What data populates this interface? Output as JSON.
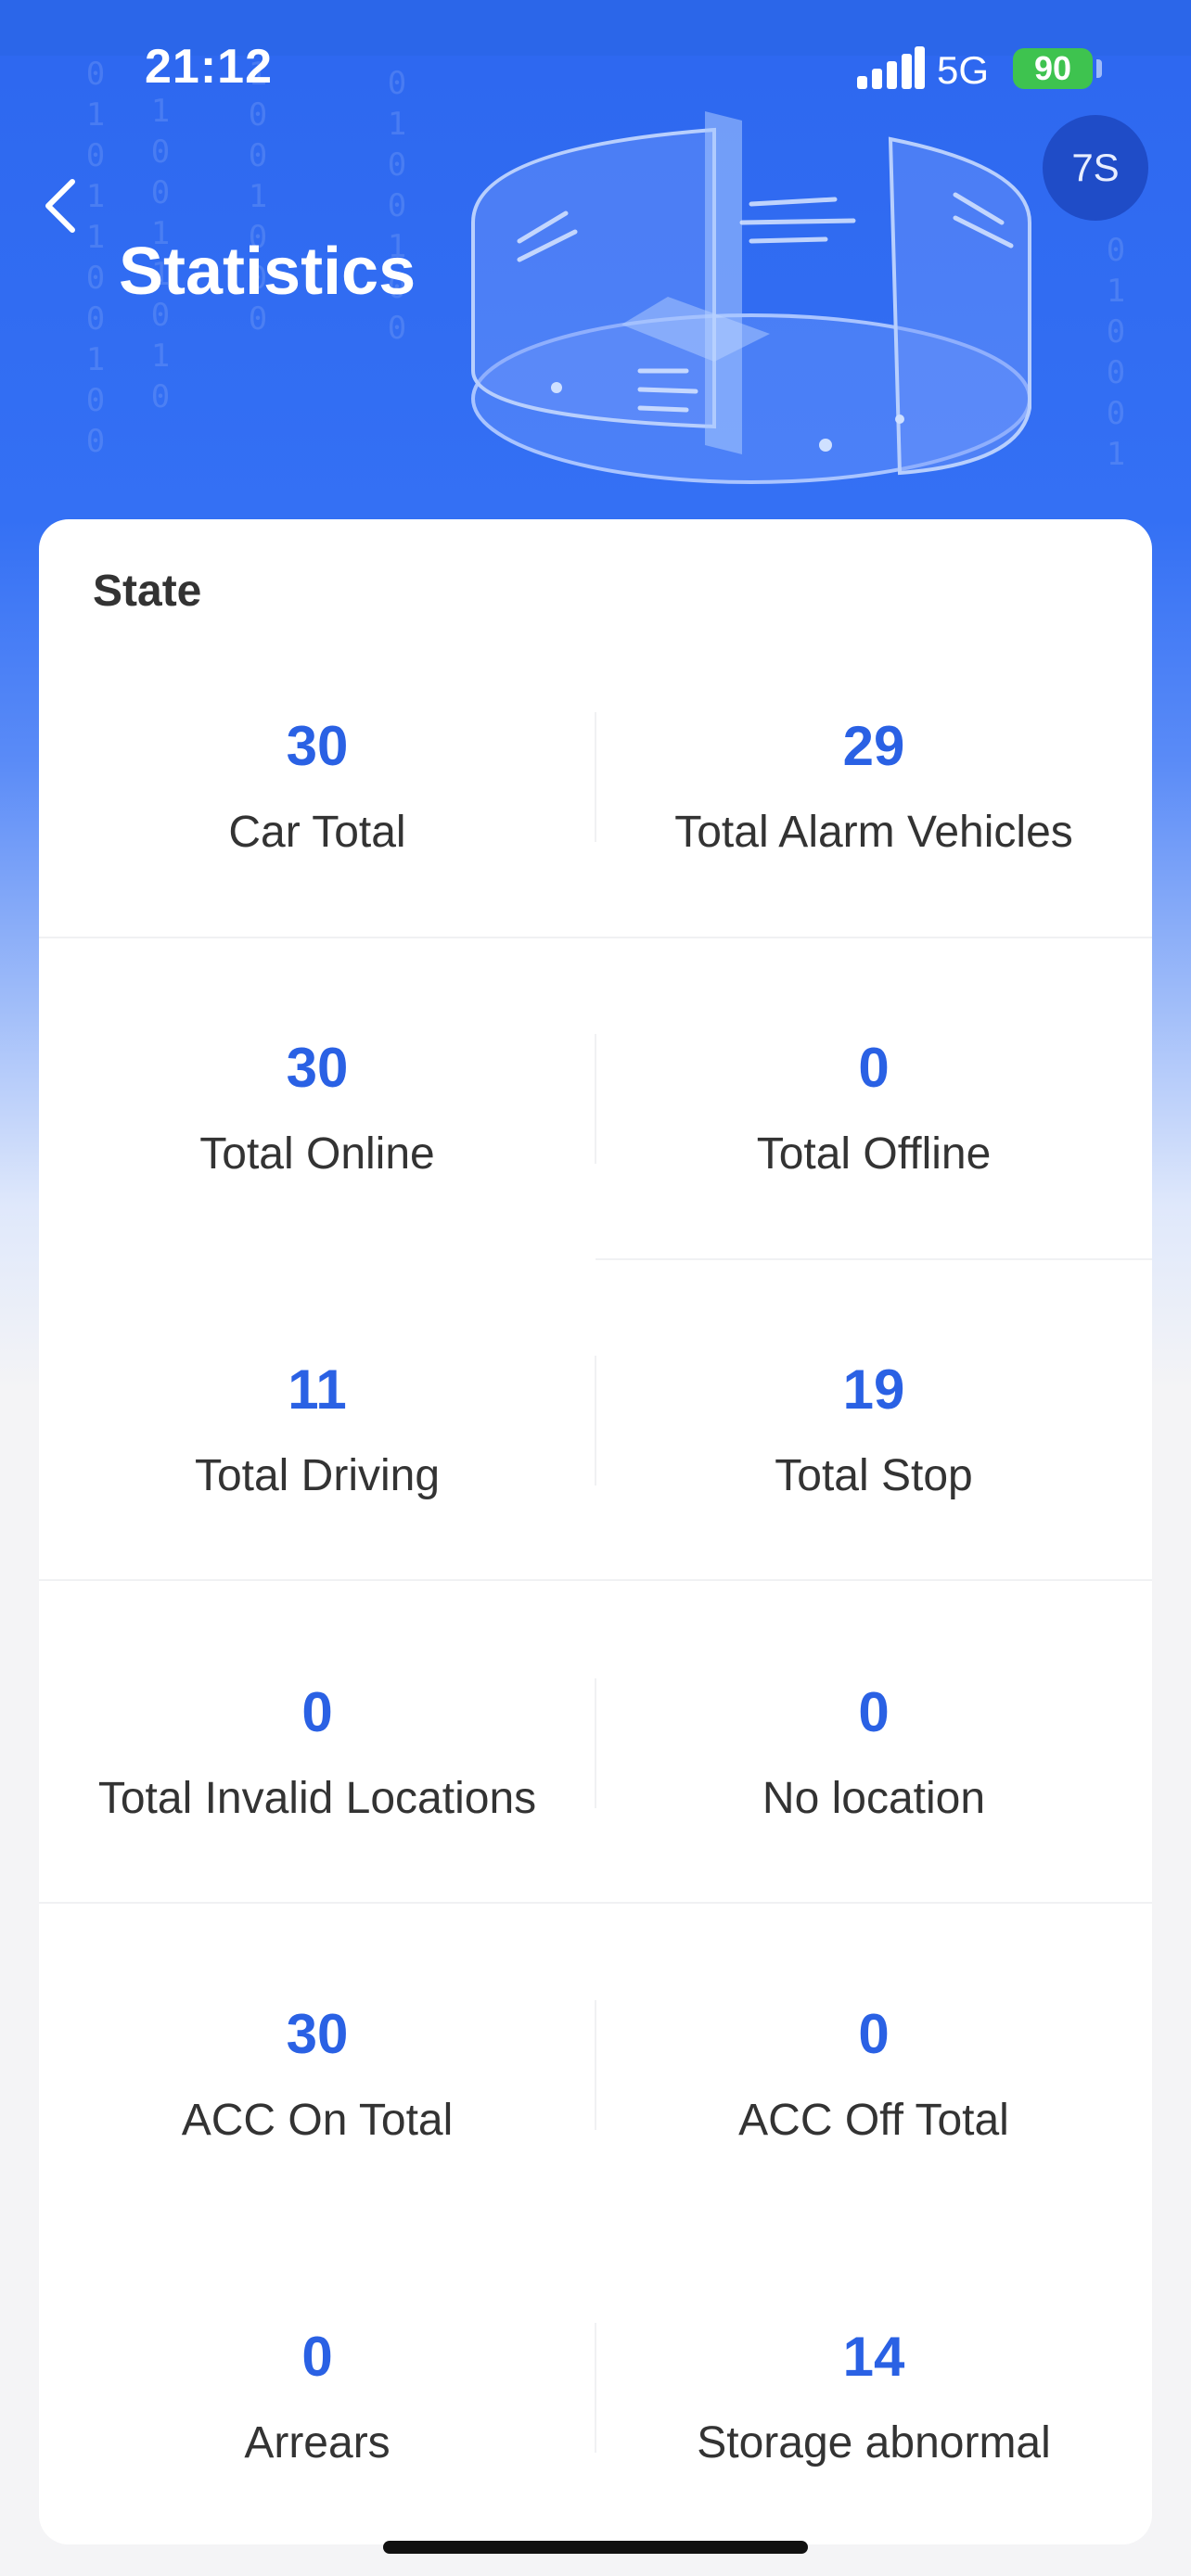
{
  "status_bar": {
    "time": "21:12",
    "network": "5G",
    "battery": "90"
  },
  "header": {
    "title": "Statistics",
    "avatar_initials": "7S",
    "back_icon": "chevron-left-icon"
  },
  "state_card": {
    "title": "State",
    "items": [
      {
        "value": "30",
        "label": "Car Total"
      },
      {
        "value": "29",
        "label": "Total Alarm Vehicles"
      },
      {
        "value": "30",
        "label": "Total Online"
      },
      {
        "value": "0",
        "label": "Total Offline"
      },
      {
        "value": "11",
        "label": "Total Driving"
      },
      {
        "value": "19",
        "label": "Total Stop"
      },
      {
        "value": "0",
        "label": "Total Invalid Locations"
      },
      {
        "value": "0",
        "label": "No location"
      },
      {
        "value": "30",
        "label": "ACC On Total"
      },
      {
        "value": "0",
        "label": "ACC Off Total"
      },
      {
        "value": "0",
        "label": "Arrears"
      },
      {
        "value": "14",
        "label": "Storage abnormal"
      }
    ]
  },
  "colors": {
    "header_blue": "#3470f4",
    "value_blue": "#2a61e4",
    "battery_green": "#3ec34f"
  }
}
